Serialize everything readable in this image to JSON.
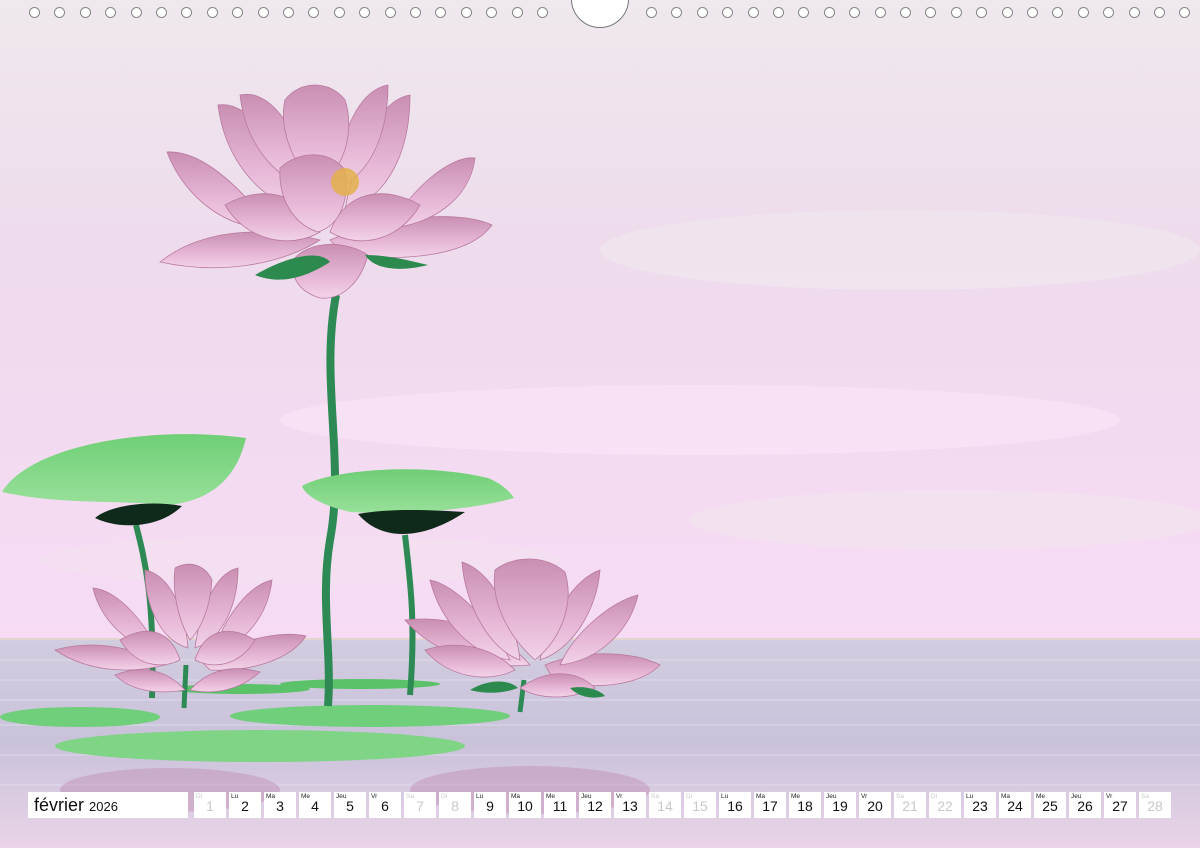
{
  "calendar": {
    "month": "février",
    "year": "2026",
    "days": [
      {
        "wd": "Di",
        "num": "1",
        "weekend": true
      },
      {
        "wd": "Lu",
        "num": "2",
        "weekend": false
      },
      {
        "wd": "Ma",
        "num": "3",
        "weekend": false
      },
      {
        "wd": "Me",
        "num": "4",
        "weekend": false
      },
      {
        "wd": "Jeu",
        "num": "5",
        "weekend": false
      },
      {
        "wd": "Vr",
        "num": "6",
        "weekend": false
      },
      {
        "wd": "Sa",
        "num": "7",
        "weekend": true
      },
      {
        "wd": "Di",
        "num": "8",
        "weekend": true
      },
      {
        "wd": "Lu",
        "num": "9",
        "weekend": false
      },
      {
        "wd": "Ma",
        "num": "10",
        "weekend": false
      },
      {
        "wd": "Me",
        "num": "11",
        "weekend": false
      },
      {
        "wd": "Jeu",
        "num": "12",
        "weekend": false
      },
      {
        "wd": "Vr",
        "num": "13",
        "weekend": false
      },
      {
        "wd": "Sa",
        "num": "14",
        "weekend": true
      },
      {
        "wd": "Di",
        "num": "15",
        "weekend": true
      },
      {
        "wd": "Lu",
        "num": "16",
        "weekend": false
      },
      {
        "wd": "Ma",
        "num": "17",
        "weekend": false
      },
      {
        "wd": "Me",
        "num": "18",
        "weekend": false
      },
      {
        "wd": "Jeu",
        "num": "19",
        "weekend": false
      },
      {
        "wd": "Vr",
        "num": "20",
        "weekend": false
      },
      {
        "wd": "Sa",
        "num": "21",
        "weekend": true
      },
      {
        "wd": "Di",
        "num": "22",
        "weekend": true
      },
      {
        "wd": "Lu",
        "num": "23",
        "weekend": false
      },
      {
        "wd": "Ma",
        "num": "24",
        "weekend": false
      },
      {
        "wd": "Me",
        "num": "25",
        "weekend": false
      },
      {
        "wd": "Jeu",
        "num": "26",
        "weekend": false
      },
      {
        "wd": "Vr",
        "num": "27",
        "weekend": false
      },
      {
        "wd": "Sa",
        "num": "28",
        "weekend": true
      }
    ]
  },
  "colors": {
    "sky_top": "#efe8ee",
    "sky_bottom": "#f5d9f3",
    "water": "#c9c4dc",
    "petal": "#d9a3c7",
    "leaf": "#7fd47f",
    "stem": "#2e8a55"
  }
}
